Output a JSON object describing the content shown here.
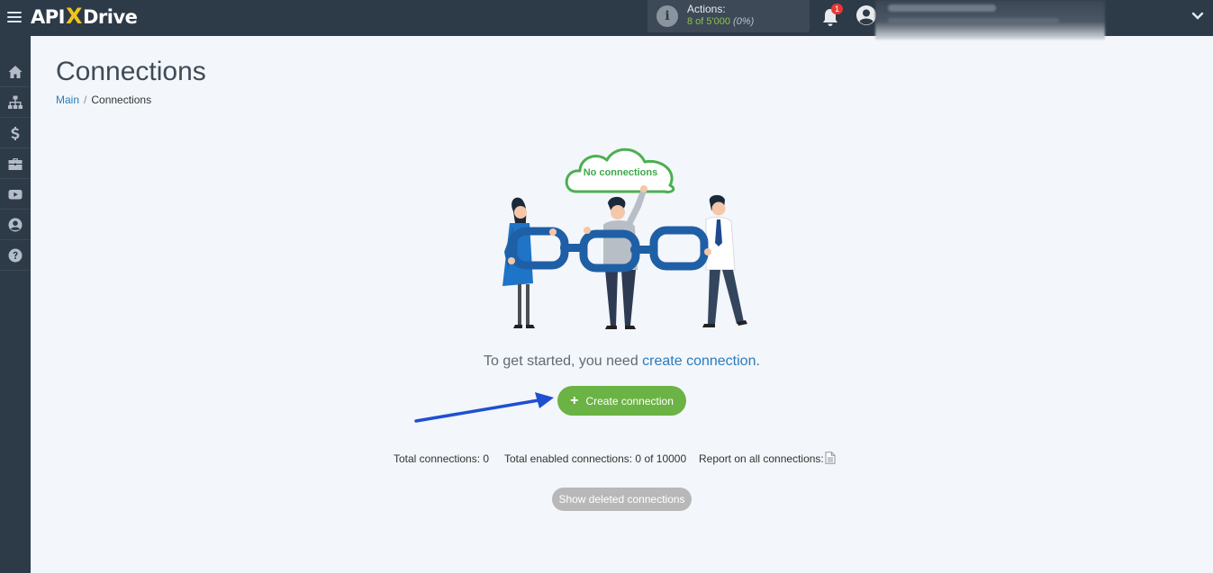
{
  "app": {
    "logo_left": "API",
    "logo_x": "X",
    "logo_right": "Drive"
  },
  "header": {
    "actions_label": "Actions:",
    "actions_value": "8 of 5'000",
    "actions_percent": "(0%)",
    "notifications_count": "1"
  },
  "sidebar": {
    "items": [
      {
        "icon": "home-icon"
      },
      {
        "icon": "sitemap-icon"
      },
      {
        "icon": "dollar-icon"
      },
      {
        "icon": "briefcase-icon"
      },
      {
        "icon": "video-icon"
      },
      {
        "icon": "user-circle-icon"
      },
      {
        "icon": "question-icon"
      }
    ]
  },
  "page": {
    "title": "Connections",
    "breadcrumb": {
      "main": "Main",
      "separator": "/",
      "current": "Connections"
    }
  },
  "empty_state": {
    "cloud_text": "No connections",
    "intro_text": "To get started, you need ",
    "intro_link": "create connection",
    "intro_end": ".",
    "create_button": "Create connection"
  },
  "stats": {
    "total": "Total connections: 0",
    "enabled": "Total enabled connections: 0 of 10000",
    "report": "Report on all connections:"
  },
  "show_deleted_button": "Show deleted connections",
  "colors": {
    "accent_green": "#6ab344",
    "link_blue": "#2b7bbd",
    "topbar": "#2d3a47",
    "chain_blue": "#1f5fa6"
  }
}
